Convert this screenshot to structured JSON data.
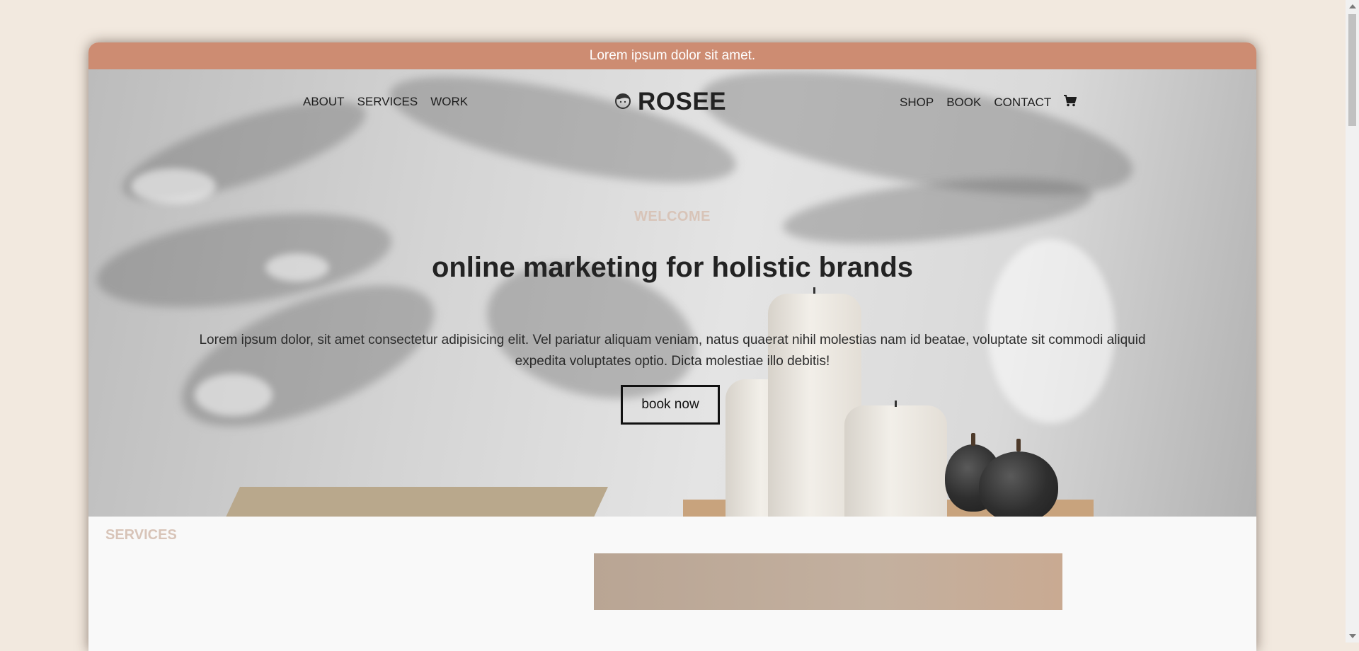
{
  "announcement": "Lorem ipsum dolor sit amet.",
  "nav": {
    "left": [
      "ABOUT",
      "SERVICES",
      "WORK"
    ],
    "right": [
      "SHOP",
      "BOOK",
      "CONTACT"
    ],
    "cart_icon": "cart-icon"
  },
  "logo": {
    "text": "ROSEE",
    "icon": "face-icon"
  },
  "hero": {
    "eyebrow": "WELCOME",
    "headline": "online marketing for holistic brands",
    "body": "Lorem ipsum dolor, sit amet consectetur adipisicing elit. Vel pariatur aliquam veniam, natus quaerat nihil molestias nam id beatae, voluptate sit commodi aliquid expedita voluptates optio. Dicta molestiae illo debitis!",
    "cta": "book now"
  },
  "services": {
    "label": "SERVICES"
  },
  "colors": {
    "page_bg": "#f2e9df",
    "announcement_bg": "#cd8c72",
    "accent_label": "#d8c4b8",
    "text": "#232323"
  }
}
